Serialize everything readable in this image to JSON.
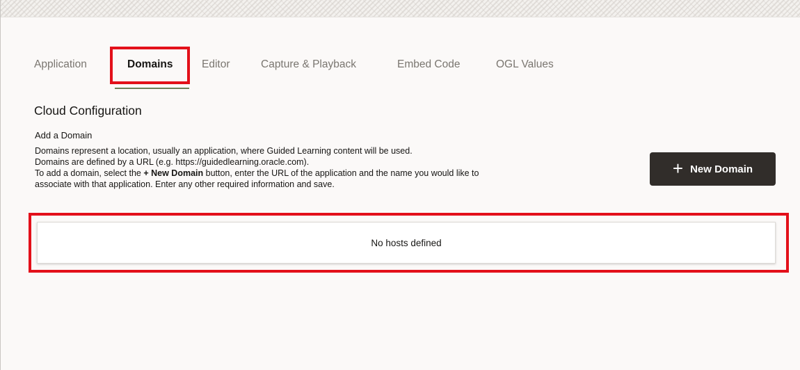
{
  "tabs": [
    {
      "label": "Application",
      "active": false
    },
    {
      "label": "Domains",
      "active": true
    },
    {
      "label": "Editor",
      "active": false
    },
    {
      "label": "Capture & Playback",
      "active": false
    },
    {
      "label": "Embed Code",
      "active": false
    },
    {
      "label": "OGL Values",
      "active": false
    }
  ],
  "section": {
    "title": "Cloud Configuration",
    "subtitle": "Add a Domain",
    "description": {
      "line1": "Domains represent a location, usually an application, where Guided Learning content will be used.",
      "line2": "Domains are defined by a URL (e.g. https://guidedlearning.oracle.com).",
      "line3_prefix": "To add a domain, select the ",
      "line3_bold": "+ New Domain",
      "line3_suffix": " button, enter the URL of the application and the name you would like to",
      "line4": "associate with that application. Enter any other required information and save."
    }
  },
  "new_domain_button": {
    "icon": "plus-icon",
    "icon_glyph": "+",
    "label": "New Domain"
  },
  "hosts": {
    "empty_message": "No hosts defined"
  },
  "colors": {
    "highlight": "#e3101a",
    "button_bg": "#312d2a",
    "tab_underline": "#6f7f5a",
    "inactive_tab": "#7a7670"
  }
}
